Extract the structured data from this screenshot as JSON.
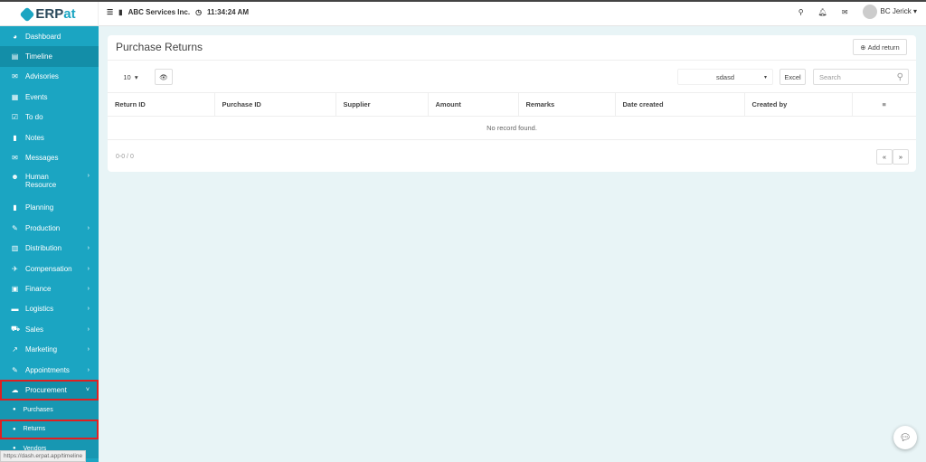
{
  "app": {
    "logo_text": "ERP",
    "logo_accent": "at"
  },
  "topbar": {
    "company": "ABC Services Inc.",
    "time": "11:34:24 AM",
    "user": "BC Jerick"
  },
  "sidebar": {
    "items": [
      {
        "label": "Dashboard",
        "icon": "◕"
      },
      {
        "label": "Timeline",
        "icon": "▤"
      },
      {
        "label": "Advisories",
        "icon": "✉"
      },
      {
        "label": "Events",
        "icon": "▦"
      },
      {
        "label": "To do",
        "icon": "☑"
      },
      {
        "label": "Notes",
        "icon": "▮"
      },
      {
        "label": "Messages",
        "icon": "✉"
      },
      {
        "label": "Human Resource",
        "icon": "☻"
      },
      {
        "label": "Planning",
        "icon": "▮"
      },
      {
        "label": "Production",
        "icon": "✎"
      },
      {
        "label": "Distribution",
        "icon": "▥"
      },
      {
        "label": "Compensation",
        "icon": "✈"
      },
      {
        "label": "Finance",
        "icon": "▣"
      },
      {
        "label": "Logistics",
        "icon": "▬"
      },
      {
        "label": "Sales",
        "icon": "⛟"
      },
      {
        "label": "Marketing",
        "icon": "↗"
      },
      {
        "label": "Appointments",
        "icon": "✎"
      },
      {
        "label": "Procurement",
        "icon": "☁"
      }
    ],
    "sub_items": [
      {
        "label": "Purchases"
      },
      {
        "label": "Returns"
      },
      {
        "label": "Vendors"
      }
    ],
    "status_url": "https://dash.erpat.app/timeline"
  },
  "main": {
    "title": "Purchase Returns",
    "add_button": "Add return",
    "page_size": "10",
    "filter_value": "sdasd",
    "excel": "Excel",
    "search_placeholder": "Search",
    "columns": [
      "Return ID",
      "Purchase ID",
      "Supplier",
      "Amount",
      "Remarks",
      "Date created",
      "Created by"
    ],
    "empty": "No record found.",
    "pagination": "0-0 / 0"
  }
}
